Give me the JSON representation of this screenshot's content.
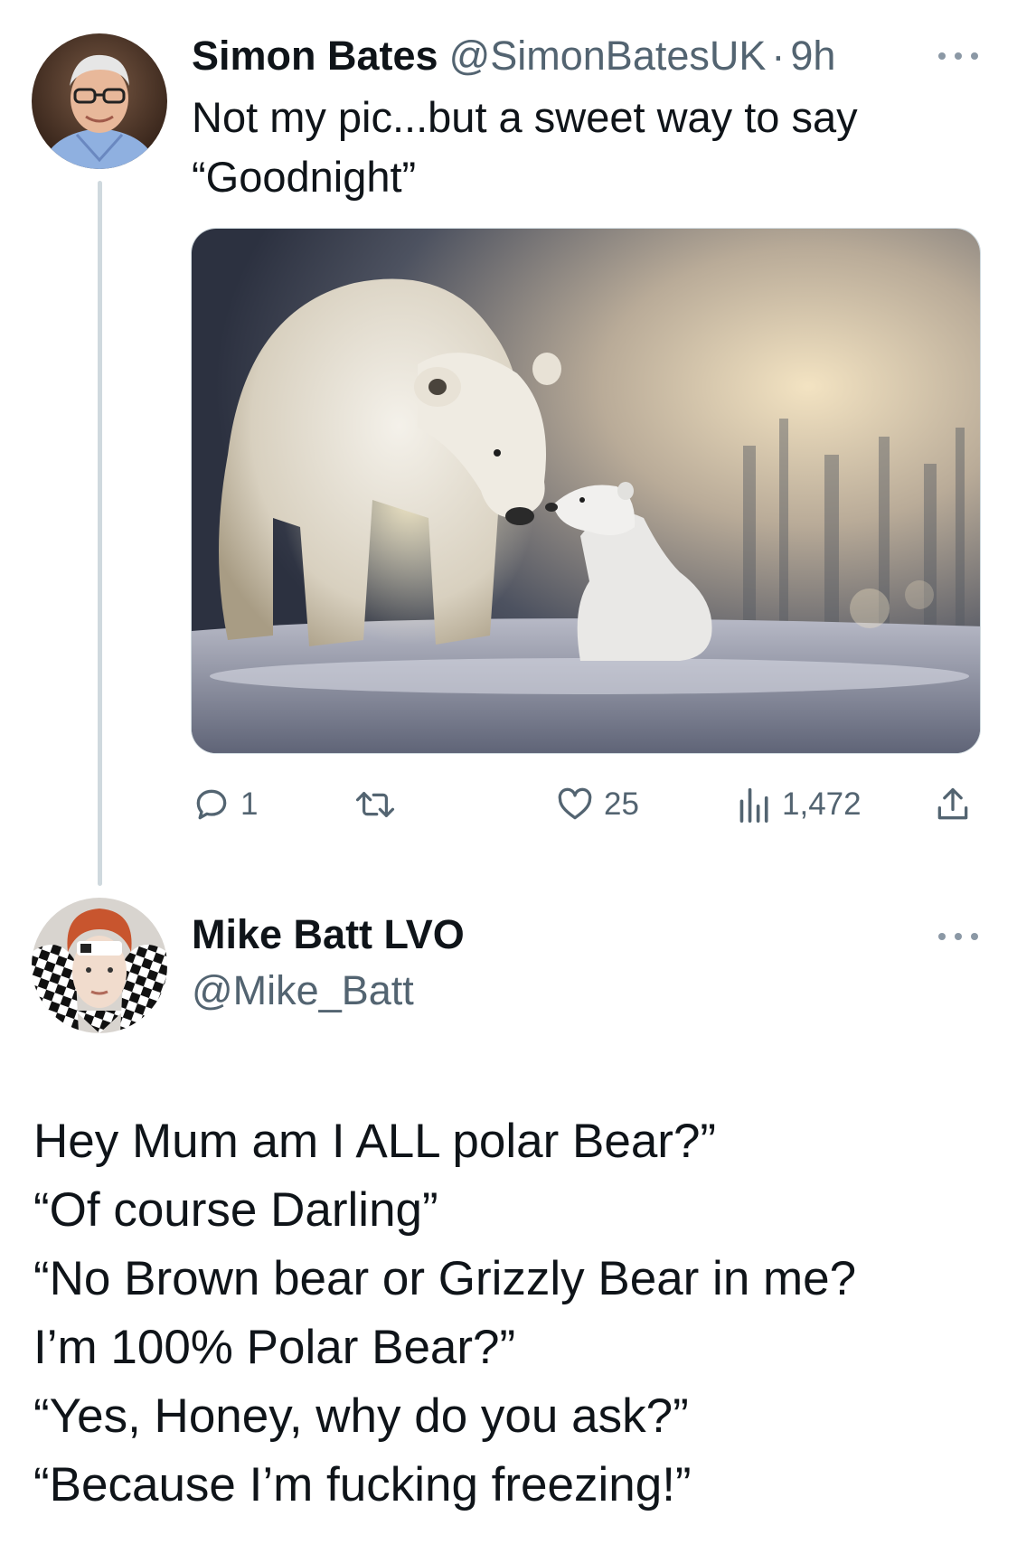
{
  "tweet1": {
    "author_name": "Simon Bates",
    "handle": "@SimonBatesUK",
    "separator": "·",
    "time": "9h",
    "text_lines": [
      "Not my pic...but a sweet way to say",
      "“Goodnight”"
    ],
    "media_alt": "polar-bear-mother-and-cub",
    "stats": {
      "replies": "1",
      "retweets": "",
      "likes": "25",
      "views": "1,472"
    }
  },
  "tweet2": {
    "author_name": "Mike Batt LVO",
    "handle": "@Mike_Batt",
    "text_lines": [
      "Hey Mum am I ALL polar Bear?”",
      "“Of course Darling”",
      "“No Brown bear or Grizzly Bear in me?",
      "I’m 100% Polar Bear?”",
      "“Yes, Honey, why do you ask?”",
      "“Because  I’m fucking freezing!”"
    ]
  },
  "icons": {
    "reply": "reply-icon",
    "retweet": "retweet-icon",
    "like": "heart-icon",
    "views": "views-icon",
    "share": "share-icon",
    "more": "more-icon"
  },
  "colors": {
    "text_primary": "#0f1419",
    "text_secondary": "#536471",
    "thread_line": "#cfd9de"
  }
}
